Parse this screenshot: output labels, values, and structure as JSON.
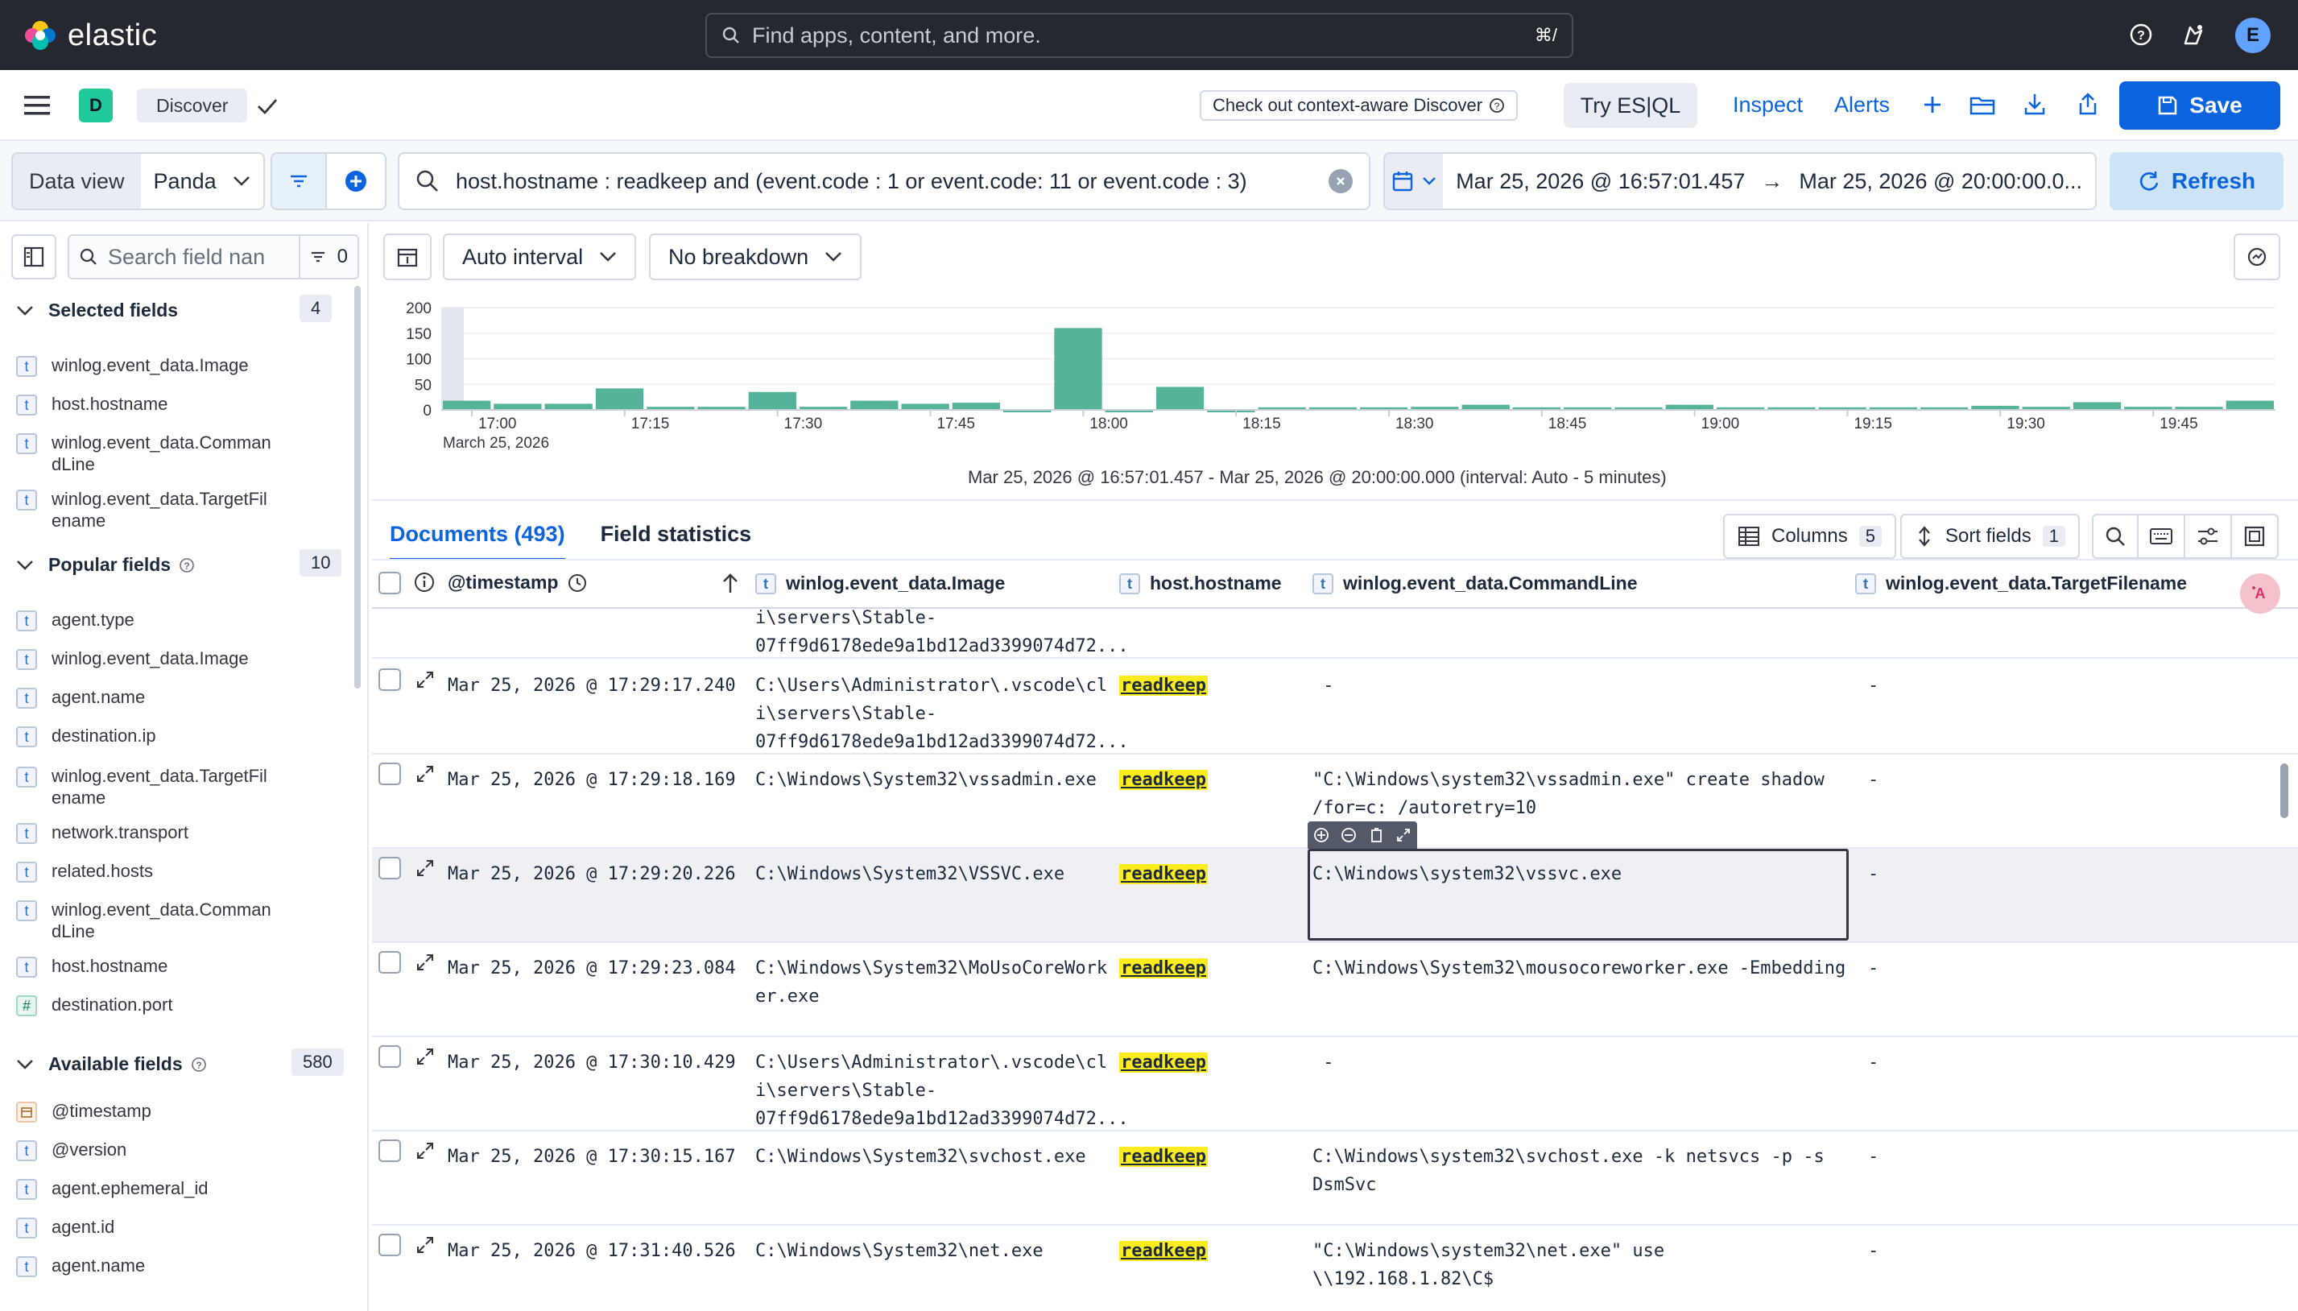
{
  "header": {
    "brand": "elastic",
    "search_placeholder": "Find apps, content, and more.",
    "search_shortcut": "⌘/",
    "user_initial": "E"
  },
  "subbar": {
    "space_letter": "D",
    "breadcrumb": "Discover",
    "context_callout": "Check out context-aware Discover",
    "try_esql": "Try ES|QL",
    "inspect": "Inspect",
    "alerts": "Alerts",
    "save": "Save"
  },
  "querybar": {
    "data_view_label": "Data view",
    "data_view_value": "Panda",
    "query": "host.hostname : readkeep and (event.code : 1 or event.code: 11 or event.code : 3)",
    "date_start": "Mar 25, 2026 @ 16:57:01.457",
    "date_arrow": "→",
    "date_end": "Mar 25, 2026 @ 20:00:00.0...",
    "refresh": "Refresh"
  },
  "sidebar": {
    "search_placeholder": "Search field nan",
    "filter_count": "0",
    "selected": {
      "title": "Selected fields",
      "count": "4",
      "items": [
        {
          "type": "t",
          "name": "winlog.event_data.Image"
        },
        {
          "type": "t",
          "name": "host.hostname"
        },
        {
          "type": "t",
          "name": "winlog.event_data.Comman\ndLine"
        },
        {
          "type": "t",
          "name": "winlog.event_data.TargetFil\nename"
        }
      ]
    },
    "popular": {
      "title": "Popular fields",
      "count": "10",
      "items": [
        {
          "type": "t",
          "name": "agent.type"
        },
        {
          "type": "t",
          "name": "winlog.event_data.Image"
        },
        {
          "type": "t",
          "name": "agent.name"
        },
        {
          "type": "t",
          "name": "destination.ip"
        },
        {
          "type": "t",
          "name": "winlog.event_data.TargetFil\nename"
        },
        {
          "type": "t",
          "name": "network.transport"
        },
        {
          "type": "t",
          "name": "related.hosts"
        },
        {
          "type": "t",
          "name": "winlog.event_data.Comman\ndLine"
        },
        {
          "type": "t",
          "name": "host.hostname"
        },
        {
          "type": "#",
          "name": "destination.port"
        }
      ]
    },
    "available": {
      "title": "Available fields",
      "count": "580",
      "items": [
        {
          "type": "cal",
          "name": "@timestamp"
        },
        {
          "type": "t",
          "name": "@version"
        },
        {
          "type": "t",
          "name": "agent.ephemeral_id"
        },
        {
          "type": "t",
          "name": "agent.id"
        },
        {
          "type": "t",
          "name": "agent.name"
        }
      ]
    }
  },
  "histogram_toolbar": {
    "interval": "Auto interval",
    "breakdown": "No breakdown"
  },
  "chart_data": {
    "type": "bar",
    "ylim": [
      0,
      200
    ],
    "y_ticks": [
      "200",
      "150",
      "100",
      "50",
      "0"
    ],
    "x_tick_labels": [
      "17:00",
      "17:15",
      "17:30",
      "17:45",
      "18:00",
      "18:15",
      "18:30",
      "18:45",
      "19:00",
      "19:15",
      "19:30",
      "19:45"
    ],
    "x_sub_label": "March 25, 2026",
    "bucket_minutes": 5,
    "values": [
      18,
      12,
      12,
      42,
      6,
      6,
      35,
      6,
      18,
      12,
      14,
      0,
      160,
      0,
      45,
      0,
      5,
      5,
      5,
      6,
      10,
      5,
      5,
      5,
      10,
      5,
      5,
      5,
      5,
      5,
      8,
      6,
      15,
      6,
      6,
      18
    ],
    "color": "#54b399",
    "range_text": "Mar 25, 2026 @ 16:57:01.457 - Mar 25, 2026 @ 20:00:00.000 (interval: Auto - 5 minutes)"
  },
  "tabs": {
    "documents": "Documents (493)",
    "field_statistics": "Field statistics"
  },
  "grid_toolbar": {
    "columns": "Columns",
    "columns_count": "5",
    "sort": "Sort fields",
    "sort_count": "1"
  },
  "grid": {
    "headers": {
      "timestamp": "@timestamp",
      "image": "winlog.event_data.Image",
      "hostname": "host.hostname",
      "commandline": "winlog.event_data.CommandLine",
      "targetfilename": "winlog.event_data.TargetFilename"
    },
    "partial_row": {
      "image": "i\\servers\\Stable-\n07ff9d6178ede9a1bd12ad3399074d72..."
    },
    "rows": [
      {
        "timestamp": "Mar 25, 2026 @ 17:29:17.240",
        "image": "C:\\Users\\Administrator\\.vscode\\cl\ni\\servers\\Stable-\n07ff9d6178ede9a1bd12ad3399074d72...",
        "hostname": "readkeep",
        "commandline": " -",
        "targetfilename": "-"
      },
      {
        "timestamp": "Mar 25, 2026 @ 17:29:18.169",
        "image": "C:\\Windows\\System32\\vssadmin.exe",
        "hostname": "readkeep",
        "commandline": "\"C:\\Windows\\system32\\vssadmin.exe\" create shadow\n/for=c: /autoretry=10",
        "targetfilename": "-"
      },
      {
        "timestamp": "Mar 25, 2026 @ 17:29:20.226",
        "image": "C:\\Windows\\System32\\VSSVC.exe",
        "hostname": "readkeep",
        "commandline": "C:\\Windows\\system32\\vssvc.exe",
        "targetfilename": "-"
      },
      {
        "timestamp": "Mar 25, 2026 @ 17:29:23.084",
        "image": "C:\\Windows\\System32\\MoUsoCoreWork\ner.exe",
        "hostname": "readkeep",
        "commandline": "C:\\Windows\\System32\\mousocoreworker.exe -Embedding",
        "targetfilename": "-"
      },
      {
        "timestamp": "Mar 25, 2026 @ 17:30:10.429",
        "image": "C:\\Users\\Administrator\\.vscode\\cl\ni\\servers\\Stable-\n07ff9d6178ede9a1bd12ad3399074d72...",
        "hostname": "readkeep",
        "commandline": " -",
        "targetfilename": "-"
      },
      {
        "timestamp": "Mar 25, 2026 @ 17:30:15.167",
        "image": "C:\\Windows\\System32\\svchost.exe",
        "hostname": "readkeep",
        "commandline": "C:\\Windows\\system32\\svchost.exe -k netsvcs -p -s\nDsmSvc",
        "targetfilename": "-"
      },
      {
        "timestamp": "Mar 25, 2026 @ 17:31:40.526",
        "image": "C:\\Windows\\System32\\net.exe",
        "hostname": "readkeep",
        "commandline": "\"C:\\Windows\\system32\\net.exe\" use\n\\\\192.168.1.82\\C$",
        "targetfilename": "-"
      }
    ]
  },
  "colors": {
    "header_bg": "#25282f",
    "accent": "#0b64dd",
    "highlight": "#fcec1e",
    "bar": "#54b399"
  }
}
